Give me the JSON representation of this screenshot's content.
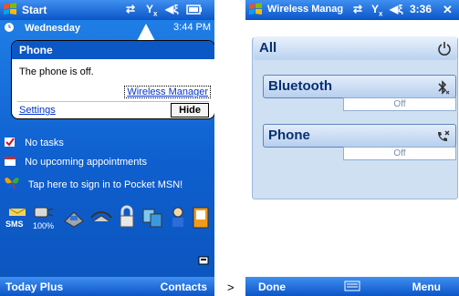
{
  "left_screen": {
    "title": "Start",
    "day": "Wednesday",
    "time_partial": "3:44 PM",
    "notification": {
      "title": "Phone",
      "message": "The phone is off.",
      "link": "Wireless Manager",
      "settings": "Settings",
      "hide": "Hide"
    },
    "today_items": [
      {
        "icon": "tasks-icon",
        "text": "No tasks"
      },
      {
        "icon": "calendar-icon",
        "text": "No upcoming appointments"
      },
      {
        "icon": "msn-butterfly-icon",
        "text": "Tap here to sign in to Pocket MSN!"
      }
    ],
    "battery_percent": "100%",
    "sms_label": "SMS",
    "softkeys": {
      "left": "Today Plus",
      "right": "Contacts"
    }
  },
  "separator": ">",
  "right_screen": {
    "title": "Wireless Manag",
    "time": "3:36",
    "all_label": "All",
    "items": [
      {
        "label": "Bluetooth",
        "state": "Off",
        "icon": "bluetooth-icon"
      },
      {
        "label": "Phone",
        "state": "Off",
        "icon": "phone-off-icon"
      }
    ],
    "softkeys": {
      "left": "Done",
      "right": "Menu"
    }
  }
}
